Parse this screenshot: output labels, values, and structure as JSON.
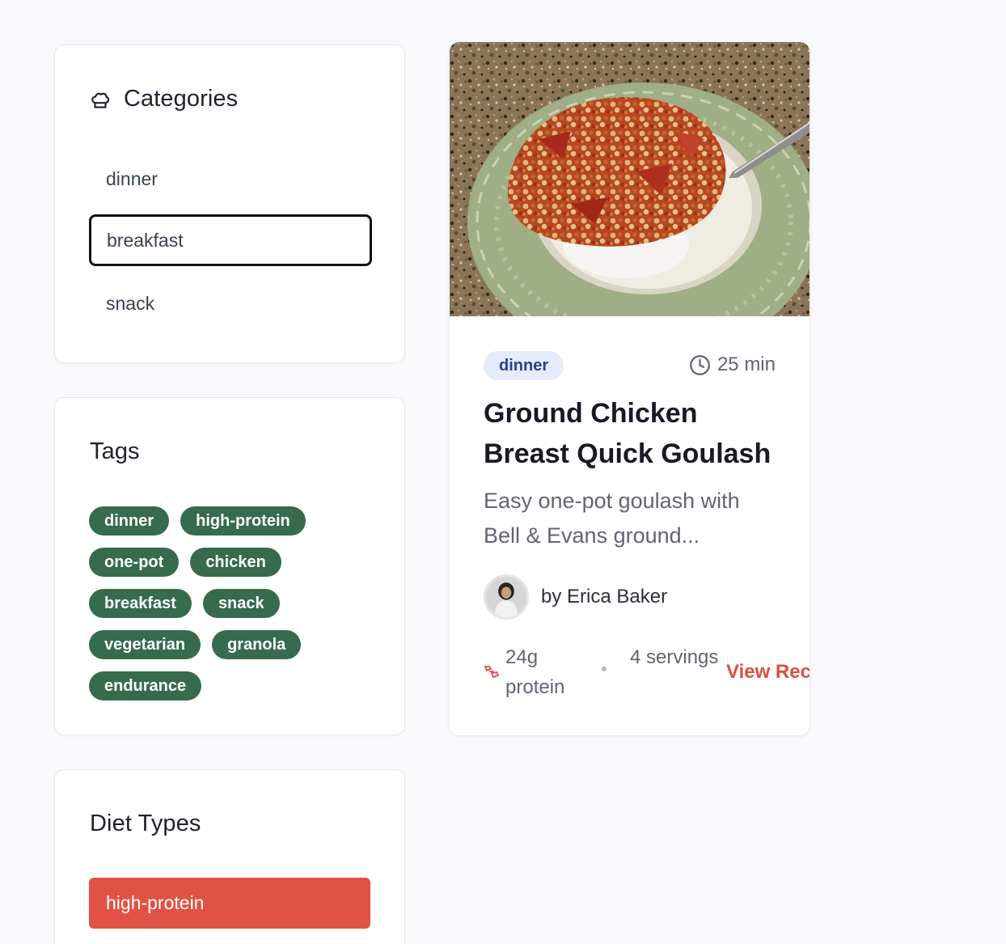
{
  "sidebar": {
    "categories": {
      "title": "Categories",
      "icon": "chef-hat-icon",
      "items": [
        {
          "label": "dinner",
          "active": false
        },
        {
          "label": "breakfast",
          "active": true
        },
        {
          "label": "snack",
          "active": false
        }
      ]
    },
    "tags": {
      "title": "Tags",
      "items": [
        "dinner",
        "high-protein",
        "one-pot",
        "chicken",
        "breakfast",
        "snack",
        "vegetarian",
        "granola",
        "endurance"
      ]
    },
    "diet_types": {
      "title": "Diet Types",
      "items": [
        {
          "label": "high-protein",
          "active": true
        }
      ]
    }
  },
  "recipe_card": {
    "category_badge": "dinner",
    "time_label": "25 min",
    "title": "Ground Chicken Breast Quick Goulash",
    "description": "Easy one-pot goulash with Bell & Evans ground...",
    "author": "by Erica Baker",
    "protein_label": "24g protein",
    "servings_label": "4 servings",
    "view_link": "View Rec",
    "icons": {
      "time": "clock-icon",
      "protein": "protein-icon"
    }
  },
  "colors": {
    "tag_bg": "#376b4d",
    "badge_bg": "#e4ebfb",
    "badge_text": "#2e3f8c",
    "accent": "#e05244",
    "page_bg": "#f8f9fb"
  }
}
